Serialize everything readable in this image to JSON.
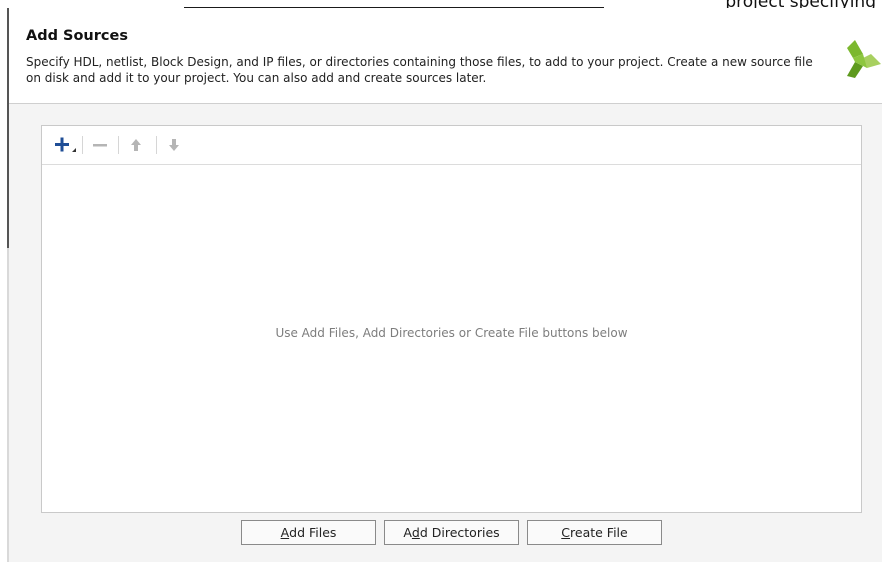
{
  "background_window": {
    "fragment_text": "project specifying"
  },
  "dialog": {
    "title": "Add Sources",
    "description": "Specify HDL, netlist, Block Design, and IP files, or directories containing those files, to add to your project. Create a new source file on disk and add it to your project. You can also add and create sources later.",
    "logo_icon": "vivado-logo-icon",
    "accent_color": "#8dc63f"
  },
  "file_list": {
    "toolbar": {
      "add_icon": "plus-icon",
      "remove_icon": "minus-icon",
      "move_up_icon": "arrow-up-icon",
      "move_down_icon": "arrow-down-icon"
    },
    "empty_message": "Use Add Files, Add Directories or Create File buttons below"
  },
  "buttons": {
    "add_files": {
      "pre": "",
      "mnemonic": "A",
      "post": "dd Files"
    },
    "add_directories": {
      "pre": "A",
      "mnemonic": "d",
      "post": "d Directories"
    },
    "create_file": {
      "pre": "",
      "mnemonic": "C",
      "post": "reate File"
    }
  }
}
